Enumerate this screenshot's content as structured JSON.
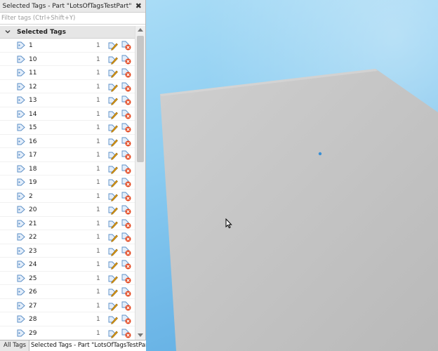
{
  "panel": {
    "title": "Selected Tags - Part \"LotsOfTagsTestPart\"",
    "close_symbol": "✖",
    "filter_placeholder": "Filter tags (Ctrl+Shift+Y)",
    "group_label": "Selected Tags"
  },
  "tags": [
    {
      "name": "1",
      "count": "1"
    },
    {
      "name": "10",
      "count": "1"
    },
    {
      "name": "11",
      "count": "1"
    },
    {
      "name": "12",
      "count": "1"
    },
    {
      "name": "13",
      "count": "1"
    },
    {
      "name": "14",
      "count": "1"
    },
    {
      "name": "15",
      "count": "1"
    },
    {
      "name": "16",
      "count": "1"
    },
    {
      "name": "17",
      "count": "1"
    },
    {
      "name": "18",
      "count": "1"
    },
    {
      "name": "19",
      "count": "1"
    },
    {
      "name": "2",
      "count": "1"
    },
    {
      "name": "20",
      "count": "1"
    },
    {
      "name": "21",
      "count": "1"
    },
    {
      "name": "22",
      "count": "1"
    },
    {
      "name": "23",
      "count": "1"
    },
    {
      "name": "24",
      "count": "1"
    },
    {
      "name": "25",
      "count": "1"
    },
    {
      "name": "26",
      "count": "1"
    },
    {
      "name": "27",
      "count": "1"
    },
    {
      "name": "28",
      "count": "1"
    },
    {
      "name": "29",
      "count": "1"
    }
  ],
  "tabs": [
    {
      "label": "All Tags"
    },
    {
      "label": "Selected Tags - Part \"LotsOfTagsTestPart\""
    }
  ],
  "colors": {
    "sky": "#8ccdf1",
    "baseplate": "#c4c4c4",
    "tag_icon": "#5b8fc7",
    "rename_pencil": "#e8a317",
    "remove_badge": "#e2461e"
  },
  "icons": [
    "chevron-down-icon",
    "tag-icon",
    "rename-tag-icon",
    "remove-tag-icon",
    "close-icon",
    "mouse-cursor-icon"
  ]
}
